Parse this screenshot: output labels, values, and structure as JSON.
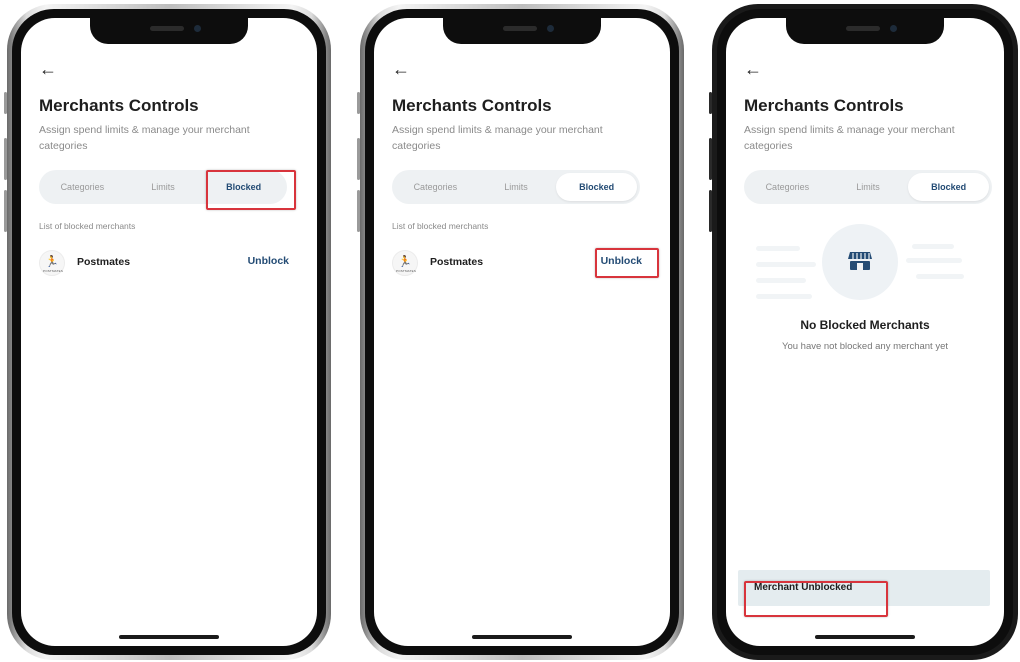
{
  "screens": [
    {
      "back_glyph": "←",
      "title": "Merchants Controls",
      "subtitle": "Assign spend limits & manage your merchant categories",
      "tabs": [
        "Categories",
        "Limits",
        "Blocked"
      ],
      "active_tab": "Blocked",
      "list_label": "List of blocked merchants",
      "merchant": {
        "logo_glyph": "🏃",
        "logo_caption": "POSTMATES",
        "name": "Postmates",
        "action": "Unblock"
      }
    },
    {
      "back_glyph": "←",
      "title": "Merchants Controls",
      "subtitle": "Assign spend limits & manage your merchant categories",
      "tabs": [
        "Categories",
        "Limits",
        "Blocked"
      ],
      "active_tab": "Blocked",
      "list_label": "List of blocked merchants",
      "merchant": {
        "logo_glyph": "🏃",
        "logo_caption": "POSTMATES",
        "name": "Postmates",
        "action": "Unblock"
      }
    },
    {
      "back_glyph": "←",
      "title": "Merchants Controls",
      "subtitle": "Assign spend limits & manage your merchant categories",
      "tabs": [
        "Categories",
        "Limits",
        "Blocked"
      ],
      "active_tab": "Blocked",
      "empty_state": {
        "icon": "store-icon",
        "title": "No Blocked Merchants",
        "message": "You have not blocked any merchant yet"
      },
      "toast": "Merchant Unblocked"
    }
  ],
  "colors": {
    "accent": "#234b74",
    "highlight": "#d8343c",
    "muted_text": "#8a8a8a",
    "tab_track": "#eef1f3",
    "toast_bg": "#e4ecef"
  }
}
